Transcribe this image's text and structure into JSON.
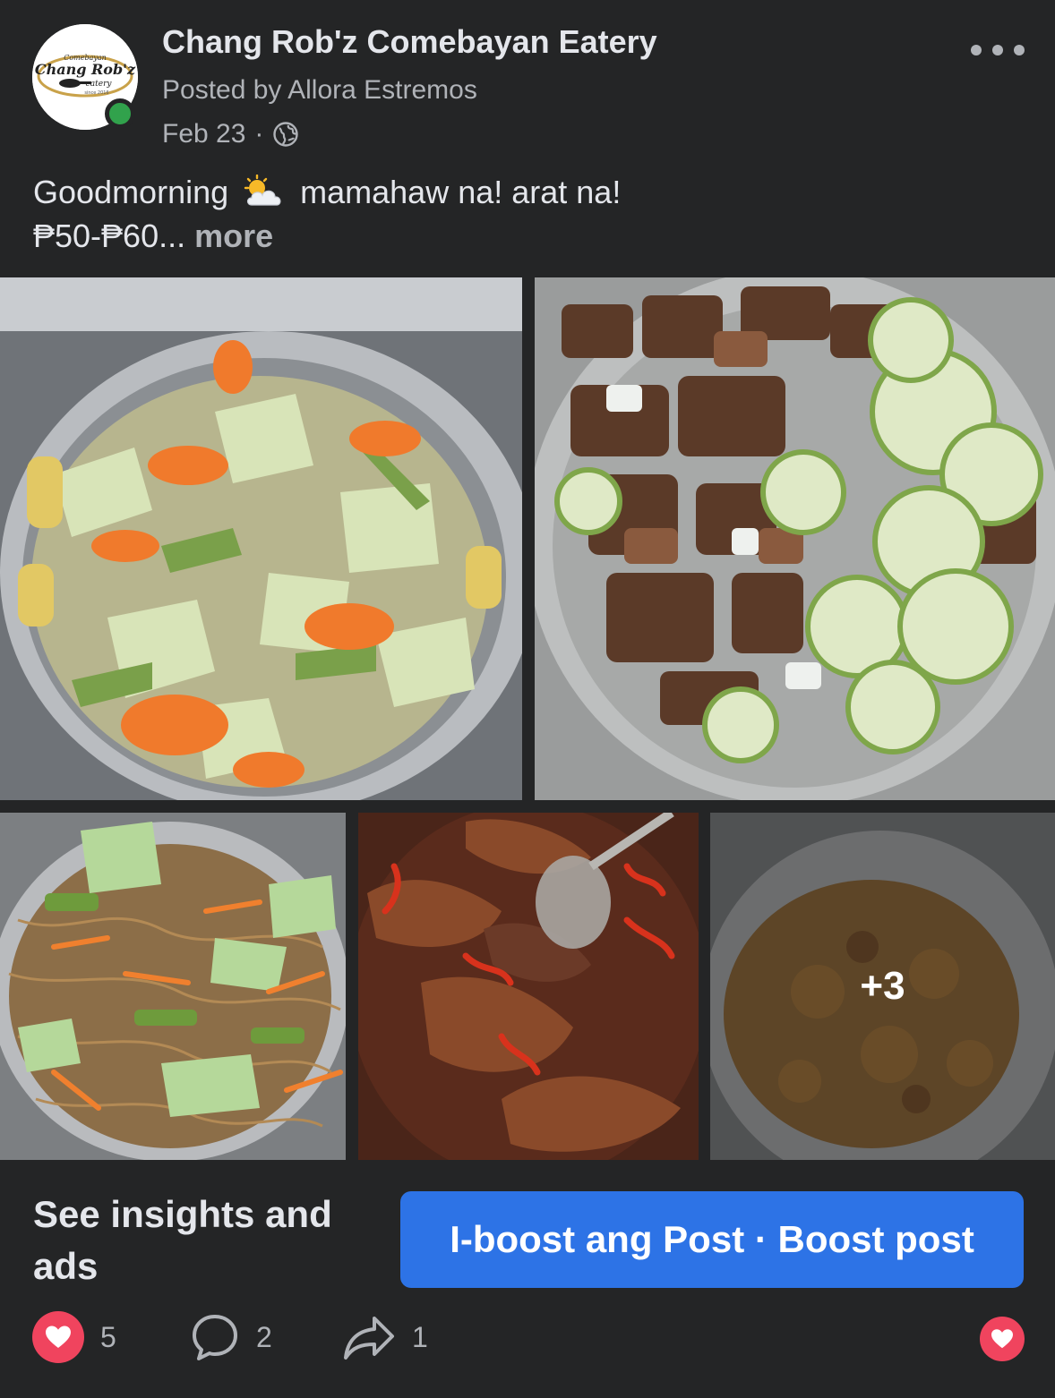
{
  "post": {
    "page_name": "Chang Rob'z Comebayan Eatery",
    "posted_by": "Posted by Allora Estremos",
    "date": "Feb 23",
    "separator": "·",
    "privacy_icon": "globe-icon",
    "menu_icon": "more-options-icon",
    "avatar": {
      "logo_text_top": "Comebayan",
      "logo_text_main": "Chang Rob'z",
      "logo_text_sub": "eatery",
      "logo_text_since": "since 2016"
    },
    "caption_line1_a": "Goodmorning",
    "caption_emoji": "sun-behind-cloud-icon",
    "caption_line1_b": "mamahaw na! arat na!",
    "caption_line2": "₱50-₱60...",
    "see_more": "more"
  },
  "gallery": {
    "photos": [
      "vegetable-chopsuey-photo",
      "pork-cucumber-salad-photo",
      "pancit-noodles-photo",
      "fish-in-sauce-photo",
      "curry-stew-photo"
    ],
    "more_count": "+3"
  },
  "insights": {
    "label": "See insights and ads",
    "boost_button": "I-boost ang Post · Boost post"
  },
  "actions": {
    "likes": "5",
    "comments": "2",
    "shares": "1"
  },
  "colors": {
    "background": "#242526",
    "primary_text": "#e4e6eb",
    "secondary_text": "#b0b3b8",
    "boost_blue": "#2d73e6",
    "heart_red": "#f0445e",
    "online_green": "#31a24c"
  }
}
